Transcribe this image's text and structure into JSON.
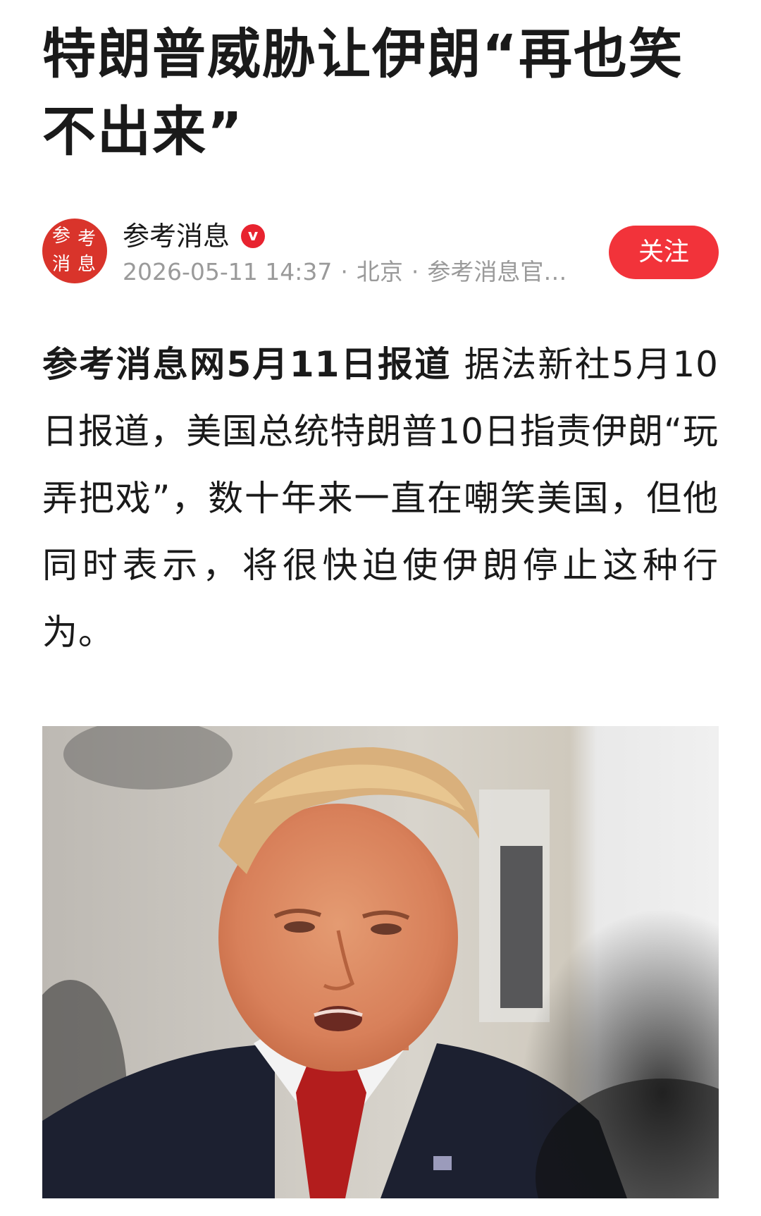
{
  "article": {
    "title": "特朗普威胁让伊朗“再也笑不出来”",
    "lead": "参考消息网5月11日报道",
    "body": "据法新社5月10日报道，美国总统特朗普10日指责伊朗“玩弄把戏”，数十年来一直在嘲笑美国，但他同时表示，将很快迫使伊朗停止这种行为。"
  },
  "author": {
    "name": "参考消息",
    "avatar_text": "参考消息",
    "verified_icon": "verified-v-badge",
    "verified_mark": "v",
    "timestamp": "2026-05-11 14:37",
    "location": "北京",
    "source": "参考消息官…",
    "separator": "·"
  },
  "actions": {
    "follow_label": "关注"
  },
  "colors": {
    "accent_red": "#f2333a",
    "avatar_red": "#d9342b",
    "meta_gray": "#9a9a9a"
  }
}
